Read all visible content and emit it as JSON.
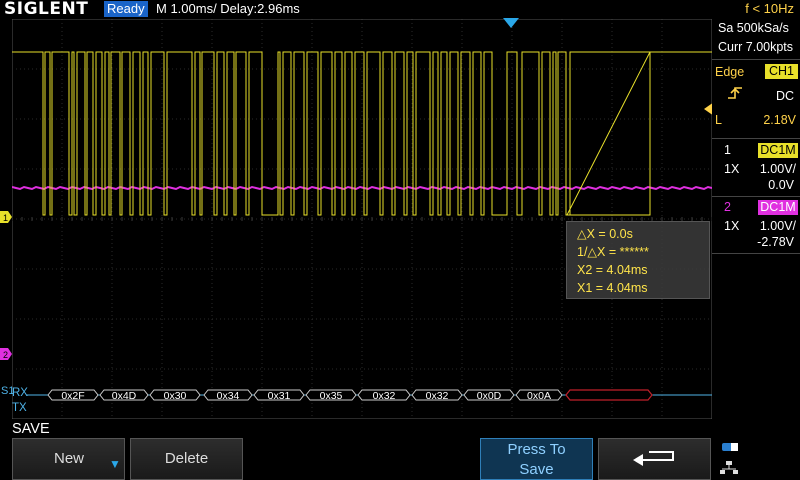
{
  "topbar": {
    "brand": "SIGLENT",
    "status": "Ready",
    "timebase": "M 1.00ms/ Delay:2.96ms",
    "trigger_freq": "f < 10Hz"
  },
  "acquisition": {
    "sample_rate": "Sa 500kSa/s",
    "memory": "Curr 7.00kpts"
  },
  "trigger": {
    "type": "Edge",
    "source": "CH1",
    "coupling": "DC",
    "level_label": "L",
    "level": "2.18V"
  },
  "channels": [
    {
      "num": "1",
      "coupling": "DC1M",
      "probe": "1X",
      "scale": "1.00V/",
      "offset": "0.0V",
      "color": "#e8e02a"
    },
    {
      "num": "2",
      "coupling": "DC1M",
      "probe": "1X",
      "scale": "1.00V/",
      "offset": "-2.78V",
      "color": "#e030e0"
    }
  ],
  "cursors": {
    "dx": "△X = 0.0s",
    "inv_dx": "1/△X = ******",
    "x2": "X2 = 4.04ms",
    "x1": "X1 = 4.04ms"
  },
  "decode": {
    "s1": "S1",
    "rx_label": "RX",
    "tx_label": "TX",
    "frames": [
      "0x2F",
      "0x4D",
      "0x30",
      "0x34",
      "0x31",
      "0x35",
      "0x32",
      "0x32",
      "0x0D",
      "0x0A"
    ]
  },
  "menu": {
    "title": "SAVE",
    "new_label": "New",
    "delete_label": "Delete",
    "press_label_line1": "Press To",
    "press_label_line2": "Save"
  },
  "colors": {
    "ch1": "#e8e02a",
    "ch2": "#e030e0",
    "accent": "#1a64c8",
    "decode": "#4fb3e8",
    "error_frame": "#c0202a"
  }
}
